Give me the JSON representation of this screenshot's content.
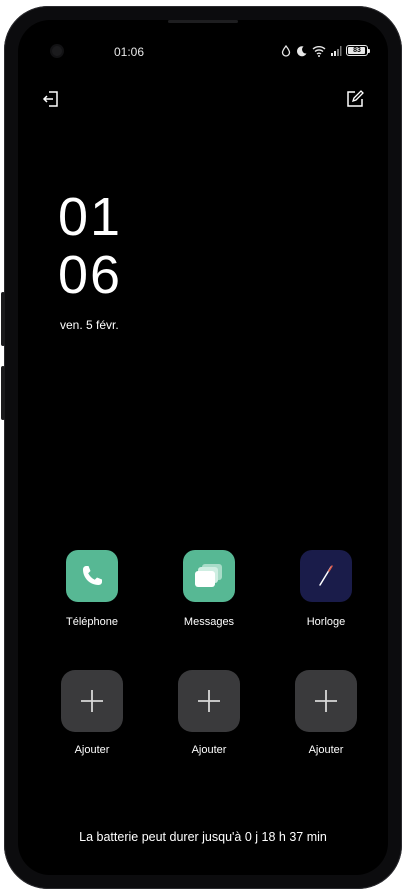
{
  "status_bar": {
    "time": "01:06",
    "icons": [
      "drop-icon",
      "moon-icon",
      "wifi-icon",
      "signal-icon",
      "battery-icon"
    ],
    "battery_level": "83"
  },
  "top_actions": {
    "left_icon": "exit-icon",
    "right_icon": "edit-icon"
  },
  "clock": {
    "hours": "01",
    "minutes": "06",
    "date": "ven. 5 févr."
  },
  "apps": [
    {
      "label": "Téléphone",
      "icon": "phone-icon",
      "color": "#57b894"
    },
    {
      "label": "Messages",
      "icon": "messages-icon",
      "color": "#57b894"
    },
    {
      "label": "Horloge",
      "icon": "clock-icon",
      "color": "#1a1c4a"
    }
  ],
  "add_slots": [
    {
      "label": "Ajouter",
      "icon": "plus-icon"
    },
    {
      "label": "Ajouter",
      "icon": "plus-icon"
    },
    {
      "label": "Ajouter",
      "icon": "plus-icon"
    }
  ],
  "footer": {
    "battery_estimate": "La batterie peut durer jusqu'à 0 j 18 h 37 min"
  },
  "colors": {
    "background": "#000000",
    "text": "#ffffff",
    "app_green": "#57b894",
    "clock_navy": "#1a1c4a",
    "add_tile": "#3a3a3c"
  }
}
